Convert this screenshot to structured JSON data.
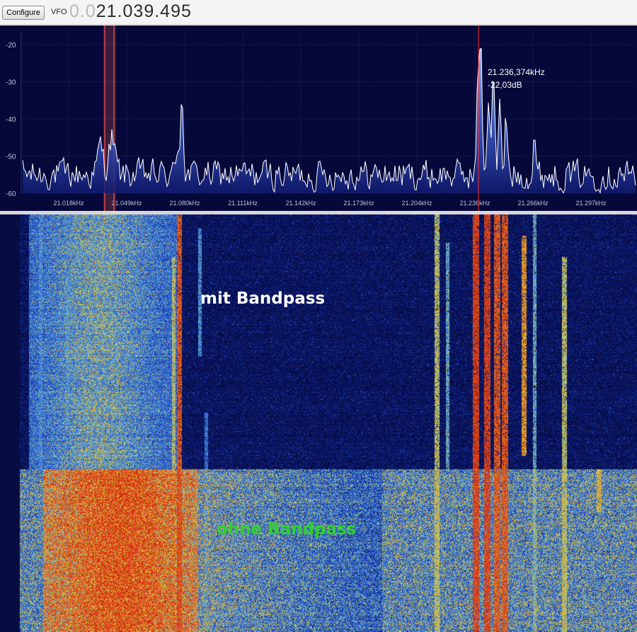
{
  "toolbar": {
    "configure_label": "Configure",
    "vfo_label": "VFO",
    "vfo_dim": "0.0",
    "vfo_value": "21.039.495"
  },
  "spectrum": {
    "db_ticks": [
      "-20",
      "-30",
      "-40",
      "-50",
      "-60"
    ],
    "db_range": [
      -60,
      -20
    ],
    "freq_ticks": [
      "21.018kHz",
      "21.049kHz",
      "21.080kHz",
      "21.111kHz",
      "21.142kHz",
      "21.173kHz",
      "21.204kHz",
      "21.236kHz",
      "21.266kHz",
      "21.297kHz"
    ],
    "cursor": {
      "freq": "21.236,374kHz",
      "level": "-22,03dB"
    },
    "colors": {
      "background": "#050838",
      "trace": "#ffffff",
      "fill": "#3a5bd8",
      "cursor": "#ff3030",
      "grid": "#2c3168",
      "labels": "#bfc3dd"
    }
  },
  "waterfall": {
    "label_top": "mit Bandpass",
    "label_bottom": "ohne Bandpass",
    "label_top_color": "#ffffff",
    "label_bottom_color": "#2fd02f"
  }
}
